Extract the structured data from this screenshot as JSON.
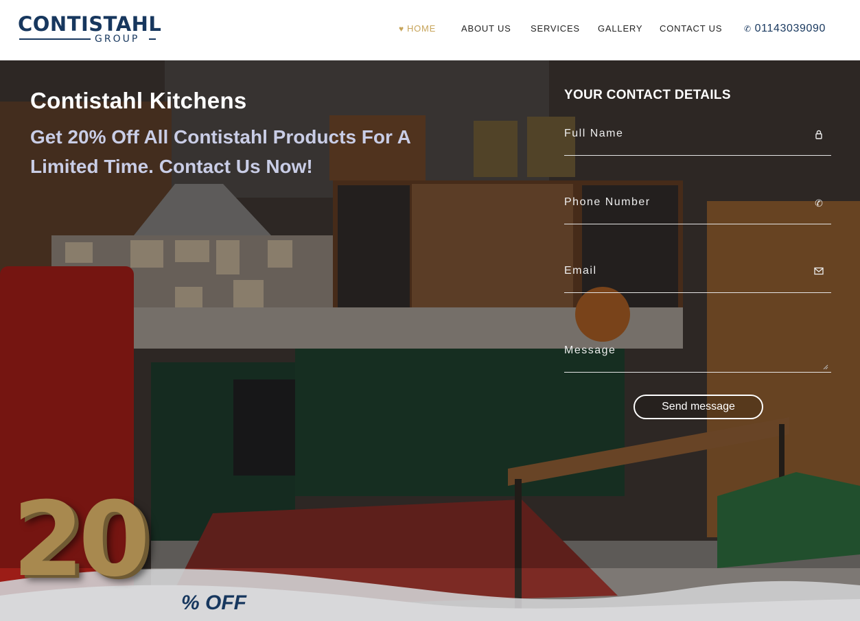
{
  "brand": {
    "name": "CONTISTAHL",
    "sub": "GROUP"
  },
  "nav": {
    "items": [
      {
        "label": "HOME",
        "active": true,
        "icon": "heart-icon"
      },
      {
        "label": "ABOUT US"
      },
      {
        "label": "SERVICES"
      },
      {
        "label": "GALLERY"
      },
      {
        "label": "CONTACT US"
      }
    ],
    "phone": "01143039090",
    "phone_icon": "phone-icon"
  },
  "hero": {
    "title": "Contistahl Kitchens",
    "subtitle": "Get 20% Off All Contistahl Products For A Limited Time. Contact Us Now!"
  },
  "form": {
    "title": "YOUR CONTACT DETAILS",
    "fields": [
      {
        "placeholder": "Full Name",
        "icon": "user-icon"
      },
      {
        "placeholder": "Phone Number",
        "icon": "phone-icon"
      },
      {
        "placeholder": "Email",
        "icon": "envelope-icon"
      },
      {
        "placeholder": "Message",
        "icon": "resize-handle-icon"
      }
    ],
    "submit_label": "Send message"
  },
  "promo": {
    "number": "20",
    "suffix": "% OFF"
  },
  "colors": {
    "brand_navy": "#17375e",
    "accent_gold": "#c7a45a"
  }
}
